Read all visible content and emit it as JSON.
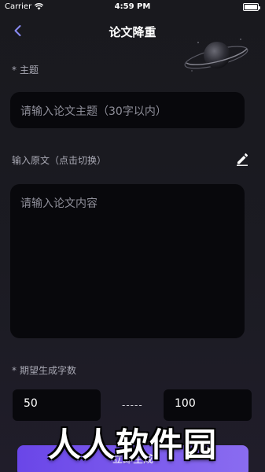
{
  "status_bar": {
    "carrier": "Carrier",
    "time": "4:59 PM"
  },
  "nav": {
    "back_icon": "chevron-left-icon",
    "title": "论文降重",
    "decoration_icon": "planet-icon"
  },
  "topic": {
    "required_mark": "*",
    "label": "主题",
    "placeholder": "请输入论文主题（30字以内）",
    "value": ""
  },
  "original": {
    "label": "输入原文（点击切换）",
    "edit_icon": "pencil-icon",
    "placeholder": "请输入论文内容",
    "value": ""
  },
  "word_count": {
    "required_mark": "*",
    "label": "期望生成字数",
    "min_value": "50",
    "separator": "-----",
    "max_value": "100"
  },
  "submit": {
    "label": "立即生成"
  },
  "watermark": {
    "text": "人人软件园"
  },
  "colors": {
    "background": "#1a1a20",
    "input_background": "#08080c",
    "accent": "#7b5cf0",
    "label": "#a9a9b4"
  }
}
